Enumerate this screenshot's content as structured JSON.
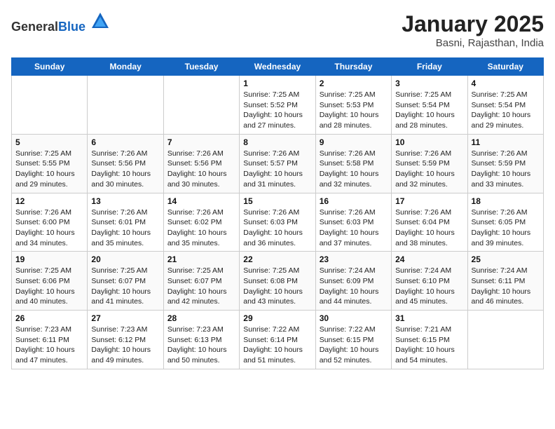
{
  "header": {
    "logo_general": "General",
    "logo_blue": "Blue",
    "month_title": "January 2025",
    "subtitle": "Basni, Rajasthan, India"
  },
  "days_of_week": [
    "Sunday",
    "Monday",
    "Tuesday",
    "Wednesday",
    "Thursday",
    "Friday",
    "Saturday"
  ],
  "weeks": [
    [
      {
        "day": "",
        "info": ""
      },
      {
        "day": "",
        "info": ""
      },
      {
        "day": "",
        "info": ""
      },
      {
        "day": "1",
        "info": "Sunrise: 7:25 AM\nSunset: 5:52 PM\nDaylight: 10 hours\nand 27 minutes."
      },
      {
        "day": "2",
        "info": "Sunrise: 7:25 AM\nSunset: 5:53 PM\nDaylight: 10 hours\nand 28 minutes."
      },
      {
        "day": "3",
        "info": "Sunrise: 7:25 AM\nSunset: 5:54 PM\nDaylight: 10 hours\nand 28 minutes."
      },
      {
        "day": "4",
        "info": "Sunrise: 7:25 AM\nSunset: 5:54 PM\nDaylight: 10 hours\nand 29 minutes."
      }
    ],
    [
      {
        "day": "5",
        "info": "Sunrise: 7:25 AM\nSunset: 5:55 PM\nDaylight: 10 hours\nand 29 minutes."
      },
      {
        "day": "6",
        "info": "Sunrise: 7:26 AM\nSunset: 5:56 PM\nDaylight: 10 hours\nand 30 minutes."
      },
      {
        "day": "7",
        "info": "Sunrise: 7:26 AM\nSunset: 5:56 PM\nDaylight: 10 hours\nand 30 minutes."
      },
      {
        "day": "8",
        "info": "Sunrise: 7:26 AM\nSunset: 5:57 PM\nDaylight: 10 hours\nand 31 minutes."
      },
      {
        "day": "9",
        "info": "Sunrise: 7:26 AM\nSunset: 5:58 PM\nDaylight: 10 hours\nand 32 minutes."
      },
      {
        "day": "10",
        "info": "Sunrise: 7:26 AM\nSunset: 5:59 PM\nDaylight: 10 hours\nand 32 minutes."
      },
      {
        "day": "11",
        "info": "Sunrise: 7:26 AM\nSunset: 5:59 PM\nDaylight: 10 hours\nand 33 minutes."
      }
    ],
    [
      {
        "day": "12",
        "info": "Sunrise: 7:26 AM\nSunset: 6:00 PM\nDaylight: 10 hours\nand 34 minutes."
      },
      {
        "day": "13",
        "info": "Sunrise: 7:26 AM\nSunset: 6:01 PM\nDaylight: 10 hours\nand 35 minutes."
      },
      {
        "day": "14",
        "info": "Sunrise: 7:26 AM\nSunset: 6:02 PM\nDaylight: 10 hours\nand 35 minutes."
      },
      {
        "day": "15",
        "info": "Sunrise: 7:26 AM\nSunset: 6:03 PM\nDaylight: 10 hours\nand 36 minutes."
      },
      {
        "day": "16",
        "info": "Sunrise: 7:26 AM\nSunset: 6:03 PM\nDaylight: 10 hours\nand 37 minutes."
      },
      {
        "day": "17",
        "info": "Sunrise: 7:26 AM\nSunset: 6:04 PM\nDaylight: 10 hours\nand 38 minutes."
      },
      {
        "day": "18",
        "info": "Sunrise: 7:26 AM\nSunset: 6:05 PM\nDaylight: 10 hours\nand 39 minutes."
      }
    ],
    [
      {
        "day": "19",
        "info": "Sunrise: 7:25 AM\nSunset: 6:06 PM\nDaylight: 10 hours\nand 40 minutes."
      },
      {
        "day": "20",
        "info": "Sunrise: 7:25 AM\nSunset: 6:07 PM\nDaylight: 10 hours\nand 41 minutes."
      },
      {
        "day": "21",
        "info": "Sunrise: 7:25 AM\nSunset: 6:07 PM\nDaylight: 10 hours\nand 42 minutes."
      },
      {
        "day": "22",
        "info": "Sunrise: 7:25 AM\nSunset: 6:08 PM\nDaylight: 10 hours\nand 43 minutes."
      },
      {
        "day": "23",
        "info": "Sunrise: 7:24 AM\nSunset: 6:09 PM\nDaylight: 10 hours\nand 44 minutes."
      },
      {
        "day": "24",
        "info": "Sunrise: 7:24 AM\nSunset: 6:10 PM\nDaylight: 10 hours\nand 45 minutes."
      },
      {
        "day": "25",
        "info": "Sunrise: 7:24 AM\nSunset: 6:11 PM\nDaylight: 10 hours\nand 46 minutes."
      }
    ],
    [
      {
        "day": "26",
        "info": "Sunrise: 7:23 AM\nSunset: 6:11 PM\nDaylight: 10 hours\nand 47 minutes."
      },
      {
        "day": "27",
        "info": "Sunrise: 7:23 AM\nSunset: 6:12 PM\nDaylight: 10 hours\nand 49 minutes."
      },
      {
        "day": "28",
        "info": "Sunrise: 7:23 AM\nSunset: 6:13 PM\nDaylight: 10 hours\nand 50 minutes."
      },
      {
        "day": "29",
        "info": "Sunrise: 7:22 AM\nSunset: 6:14 PM\nDaylight: 10 hours\nand 51 minutes."
      },
      {
        "day": "30",
        "info": "Sunrise: 7:22 AM\nSunset: 6:15 PM\nDaylight: 10 hours\nand 52 minutes."
      },
      {
        "day": "31",
        "info": "Sunrise: 7:21 AM\nSunset: 6:15 PM\nDaylight: 10 hours\nand 54 minutes."
      },
      {
        "day": "",
        "info": ""
      }
    ]
  ]
}
